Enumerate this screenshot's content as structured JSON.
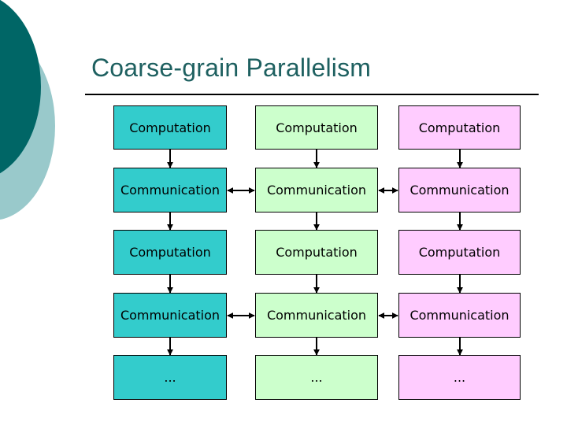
{
  "slide": {
    "title": "Coarse-grain Parallelism"
  },
  "colors": {
    "column_fills": [
      "#33cccc",
      "#ccffcc",
      "#ffccff"
    ],
    "title": "#1e6060",
    "decor_dark": "#006666",
    "decor_light": "#99c9cb"
  },
  "grid": {
    "columns": 3,
    "rows": [
      {
        "type": "computation",
        "labels": [
          "Computation",
          "Computation",
          "Computation"
        ]
      },
      {
        "type": "communication",
        "labels": [
          "Communication",
          "Communication",
          "Communication"
        ]
      },
      {
        "type": "computation",
        "labels": [
          "Computation",
          "Computation",
          "Computation"
        ]
      },
      {
        "type": "communication",
        "labels": [
          "Communication",
          "Communication",
          "Communication"
        ]
      },
      {
        "type": "continuation",
        "labels": [
          "...",
          "...",
          "..."
        ]
      }
    ]
  }
}
